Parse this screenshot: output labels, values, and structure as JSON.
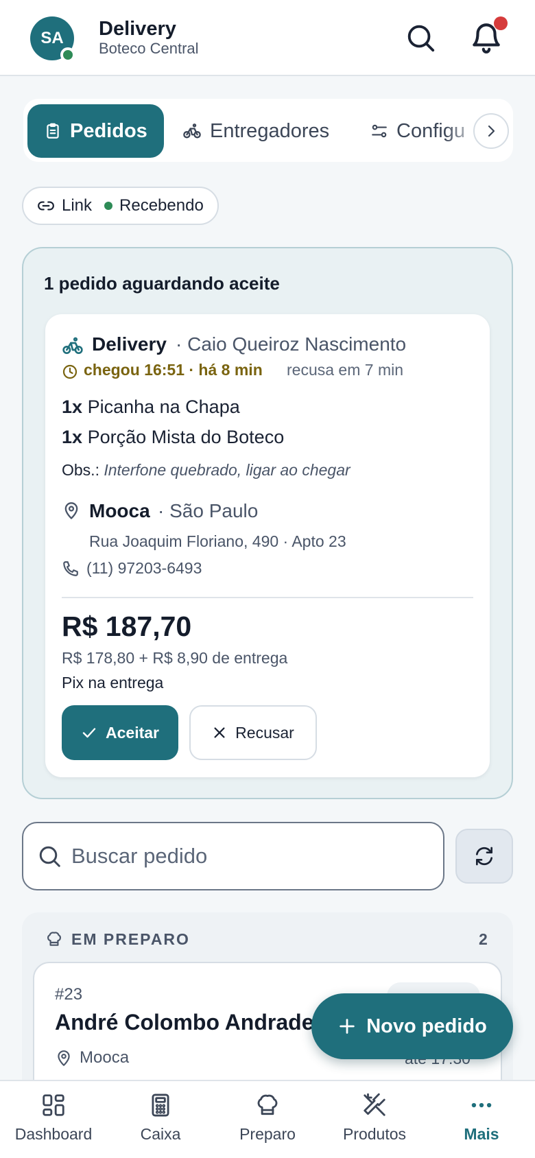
{
  "header": {
    "avatar_initials": "SA",
    "title": "Delivery",
    "subtitle": "Boteco Central"
  },
  "tabs": [
    {
      "label": "Pedidos",
      "icon": "clipboard-icon",
      "active": true
    },
    {
      "label": "Entregadores",
      "icon": "bike-icon",
      "active": false
    },
    {
      "label": "Configu",
      "icon": "sliders-icon",
      "active": false
    }
  ],
  "link_status": {
    "label": "Link",
    "status": "Recebendo"
  },
  "pending": {
    "title": "1 pedido aguardando aceite",
    "order": {
      "type": "Delivery",
      "customer": "· Caio Queiroz Nascimento",
      "arrived": "chegou 16:51 · há 8 min",
      "refuse_in": "recusa em 7 min",
      "items": [
        {
          "qty": "1x",
          "name": "Picanha na Chapa"
        },
        {
          "qty": "1x",
          "name": "Porção Mista do Boteco"
        }
      ],
      "obs_label": "Obs.:",
      "obs_text": "Interfone quebrado, ligar ao chegar",
      "neighborhood": "Mooca",
      "city": "· São Paulo",
      "street": "Rua Joaquim Floriano, 490 · Apto 23",
      "phone": "(11) 97203-6493",
      "total": "R$ 187,70",
      "breakdown": "R$ 178,80 + R$ 8,90 de entrega",
      "payment": "Pix na entrega",
      "accept_label": "Aceitar",
      "refuse_label": "Recusar"
    }
  },
  "search": {
    "placeholder": "Buscar pedido",
    "value": ""
  },
  "section": {
    "title": "EM PREPARO",
    "count": "2",
    "ticket": {
      "number": "#23",
      "name": "André Colombo Andrade",
      "neighborhood": "Mooca",
      "until": "até 17:30"
    }
  },
  "fab": {
    "label": "Novo pedido"
  },
  "bottom_nav": [
    {
      "label": "Dashboard",
      "icon": "dashboard-icon",
      "active": false
    },
    {
      "label": "Caixa",
      "icon": "calculator-icon",
      "active": false
    },
    {
      "label": "Preparo",
      "icon": "chef-hat-icon",
      "active": false
    },
    {
      "label": "Produtos",
      "icon": "utensils-icon",
      "active": false
    },
    {
      "label": "Mais",
      "icon": "more-icon",
      "active": true
    }
  ],
  "colors": {
    "primary": "#1f6f7c",
    "online": "#2e8b57",
    "notification": "#d63b3b",
    "timer": "#7a6410"
  }
}
